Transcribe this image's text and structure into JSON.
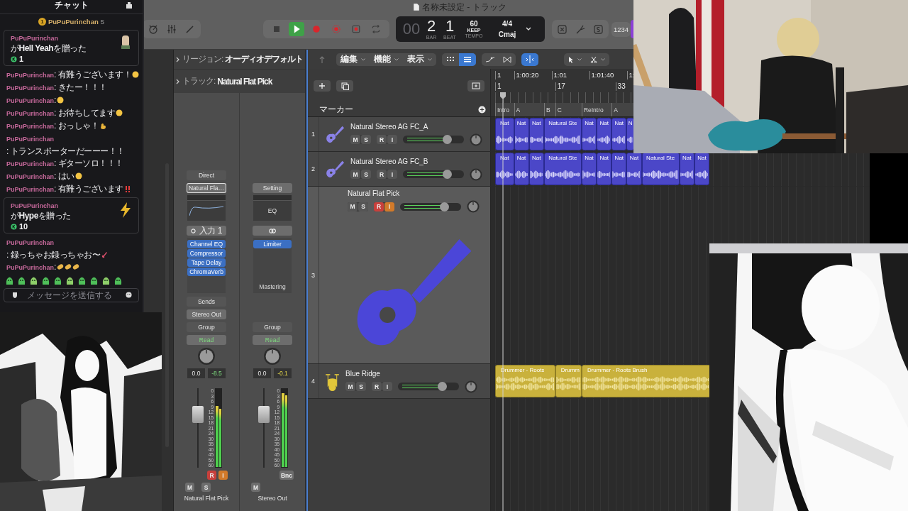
{
  "chat": {
    "title": "チャット",
    "pinned": {
      "rank": "1",
      "user": "PuPuPurinchan",
      "count": "5"
    },
    "items": [
      {
        "kind": "gift_hand",
        "user": "PuPuPurinchan",
        "text": "が**Hell Yeah**を贈った",
        "amount": "1"
      },
      {
        "kind": "message",
        "user": "PuPuPurinchan",
        "text": ": 有難うございます！",
        "emojis": [
          {
            "kind": "face"
          }
        ]
      },
      {
        "kind": "message",
        "user": "PuPuPurinchan",
        "text": ": きたー！！！"
      },
      {
        "kind": "message",
        "user": "PuPuPurinchan",
        "text": ":",
        "emojis": [
          {
            "kind": "face"
          }
        ]
      },
      {
        "kind": "message",
        "user": "PuPuPurinchan",
        "text": ": お待ちしてます",
        "emojis": [
          {
            "kind": "face"
          }
        ]
      },
      {
        "kind": "message",
        "user": "PuPuPurinchan",
        "text": ": おっしゃ！",
        "emojis": [
          {
            "kind": "arm"
          }
        ]
      },
      {
        "kind": "message",
        "user": "PuPuPurinchan",
        "text": ": トランスポーターだーーー！！"
      },
      {
        "kind": "message",
        "user": "PuPuPurinchan",
        "text": ": ギターソロ！！！"
      },
      {
        "kind": "message",
        "user": "PuPuPurinchan",
        "text": ": はい",
        "emojis": [
          {
            "kind": "face"
          }
        ]
      },
      {
        "kind": "message",
        "user": "PuPuPurinchan",
        "text": ": 有難うございます",
        "emojis": [
          {
            "kind": "bangbang"
          }
        ]
      },
      {
        "kind": "gift_bolt",
        "user": "PuPuPurinchan",
        "text": "が**Hype**を贈った",
        "amount": "10"
      },
      {
        "kind": "message",
        "user": "PuPuPurinchan",
        "text": ": 録っちゃお録っちゃお〜",
        "emojis": [
          {
            "kind": "guitar"
          }
        ]
      },
      {
        "kind": "message",
        "user": "PuPuPurinchan",
        "text": ":",
        "emojis": [
          {
            "kind": "clap"
          },
          {
            "kind": "clap"
          },
          {
            "kind": "clap"
          }
        ]
      }
    ],
    "placeholder": "メッセージを送信する"
  },
  "window": {
    "title": "名称未設定 - トラック"
  },
  "toolbar": {
    "transport": [
      {
        "kind": "stop",
        "on": false
      },
      {
        "kind": "play",
        "on": true
      },
      {
        "kind": "record",
        "on": false
      },
      {
        "kind": "capture",
        "on": false
      },
      {
        "kind": "punch",
        "on": false
      },
      {
        "kind": "cycle",
        "on": false
      }
    ],
    "lcd": {
      "bar_lead": "00",
      "bar": "2",
      "beat": "1",
      "bar_label": "BAR",
      "beat_label": "BEAT",
      "tempo": "60",
      "tempo_mode": "KEEP",
      "tempo_label": "TEMPO",
      "signature": "4/4",
      "key": "Cmaj"
    },
    "count_in": "1234"
  },
  "inspector": {
    "region": {
      "label": "リージョン:",
      "value": "オーディオデフォルト"
    },
    "track": {
      "label": "トラック:",
      "value": "Natural Flat Pick"
    },
    "strips": [
      {
        "kind": "track",
        "input": "Direct",
        "setting": "Natural Fla…",
        "input_label": "入力 1",
        "plugins": [
          "Channel EQ",
          "Compressor",
          "Tape Delay",
          "ChromaVerb"
        ],
        "sends": "Sends",
        "output": "Stereo Out",
        "group": "Group",
        "automation": "Read",
        "volume": "0.0",
        "peak": "-8.5",
        "fader": {
          "level": 0.72
        },
        "meter": {
          "level": 0.78
        },
        "scale": [
          "0",
          "3",
          "6",
          "9",
          "12",
          "15",
          "18",
          "21",
          "24",
          "30",
          "35",
          "40",
          "45",
          "50",
          "60"
        ],
        "buttons": [
          {
            "kind": "record",
            "label": "R",
            "on": true
          },
          {
            "kind": "input",
            "label": "I",
            "on": true
          },
          {
            "kind": "mute",
            "label": "M"
          },
          {
            "kind": "solo",
            "label": "S"
          }
        ],
        "name": "Natural Flat Pick"
      },
      {
        "kind": "output",
        "setting": "Setting",
        "eq": "EQ",
        "plugins": [
          "Limiter"
        ],
        "preset": "Mastering",
        "group": "Group",
        "automation": "Read",
        "volume": "0.0",
        "peak": "-0.1",
        "fader": {
          "level": 0.72
        },
        "meter": {
          "level": 0.95
        },
        "scale": [
          "0",
          "3",
          "6",
          "9",
          "12",
          "15",
          "18",
          "21",
          "24",
          "30",
          "35",
          "40",
          "45",
          "50",
          "60"
        ],
        "buttons": [
          {
            "kind": "bounce",
            "label": "Bnc"
          },
          {
            "kind": "mute",
            "label": "M"
          }
        ],
        "name": "Stereo Out"
      }
    ]
  },
  "track_area": {
    "menus": [
      {
        "label": "編集"
      },
      {
        "label": "機能"
      },
      {
        "label": "表示"
      }
    ],
    "views": [
      {
        "kind": "grid",
        "selected": false
      },
      {
        "kind": "list",
        "selected": true
      }
    ],
    "catch": {
      "on": true
    },
    "ruler": {
      "times": [
        {
          "label": "1"
        },
        {
          "label": "1:00:20"
        },
        {
          "label": "1:01"
        },
        {
          "label": "1:01:40"
        },
        {
          "label": "1:"
        }
      ],
      "bars": [
        {
          "label": "1"
        },
        {
          "label": "17"
        },
        {
          "label": "33"
        }
      ]
    },
    "markers": {
      "title": "マーカー",
      "items": [
        {
          "label": "Intro"
        },
        {
          "label": "A"
        },
        {
          "label": "B"
        },
        {
          "label": "C"
        },
        {
          "label": "ReIntro"
        },
        {
          "label": "A"
        }
      ]
    },
    "tracks": [
      {
        "number": "1",
        "name": "Natural Stereo AG FC_A",
        "kind": "guitar",
        "selected": false,
        "expanded": false,
        "buttons": [
          {
            "kind": "mute",
            "label": "M"
          },
          {
            "kind": "solo",
            "label": "S"
          },
          {
            "kind": "record",
            "label": "R",
            "on": false
          },
          {
            "kind": "input",
            "label": "I",
            "on": false
          }
        ],
        "volume": {
          "level": 0.76
        },
        "regions": [
          {
            "label": "Nat"
          },
          {
            "label": "Nat"
          },
          {
            "label": "Nat"
          },
          {
            "label": "Natural Ste"
          },
          {
            "label": "Nat"
          },
          {
            "label": "Nat"
          },
          {
            "label": "Nat"
          },
          {
            "label": "N"
          }
        ]
      },
      {
        "number": "2",
        "name": "Natural Stereo AG FC_B",
        "kind": "guitar",
        "selected": false,
        "expanded": false,
        "buttons": [
          {
            "kind": "mute",
            "label": "M"
          },
          {
            "kind": "solo",
            "label": "S"
          },
          {
            "kind": "record",
            "label": "R",
            "on": false
          },
          {
            "kind": "input",
            "label": "I",
            "on": false
          }
        ],
        "volume": {
          "level": 0.76
        },
        "regions": [
          {
            "label": "Nat"
          },
          {
            "label": "Nat"
          },
          {
            "label": "Nat"
          },
          {
            "label": "Natural Ste"
          },
          {
            "label": "Nat"
          },
          {
            "label": "Nat"
          },
          {
            "label": "Nat"
          },
          {
            "label": "Nat"
          },
          {
            "label": "Natural Ste"
          },
          {
            "label": "Nat"
          },
          {
            "label": "Nat"
          }
        ]
      },
      {
        "number": "3",
        "name": "Natural Flat Pick",
        "kind": "guitar",
        "selected": true,
        "expanded": true,
        "buttons": [
          {
            "kind": "mute",
            "label": "M"
          },
          {
            "kind": "solo",
            "label": "S"
          },
          {
            "kind": "record",
            "label": "R",
            "on": true
          },
          {
            "kind": "input",
            "label": "I",
            "on": true
          }
        ],
        "volume": {
          "level": 0.76
        }
      },
      {
        "number": "4",
        "name": "Blue Ridge",
        "kind": "drums",
        "selected": false,
        "expanded": false,
        "buttons": [
          {
            "kind": "mute",
            "label": "M"
          },
          {
            "kind": "solo",
            "label": "S"
          },
          {
            "kind": "record",
            "label": "R",
            "on": false
          },
          {
            "kind": "input",
            "label": "I",
            "on": false
          }
        ],
        "volume": {
          "level": 0.76
        },
        "regions": [
          {
            "label": "Drummer - Roots"
          },
          {
            "label": "Drumm"
          },
          {
            "label": "Drummer - Roots Brush"
          }
        ]
      }
    ]
  }
}
